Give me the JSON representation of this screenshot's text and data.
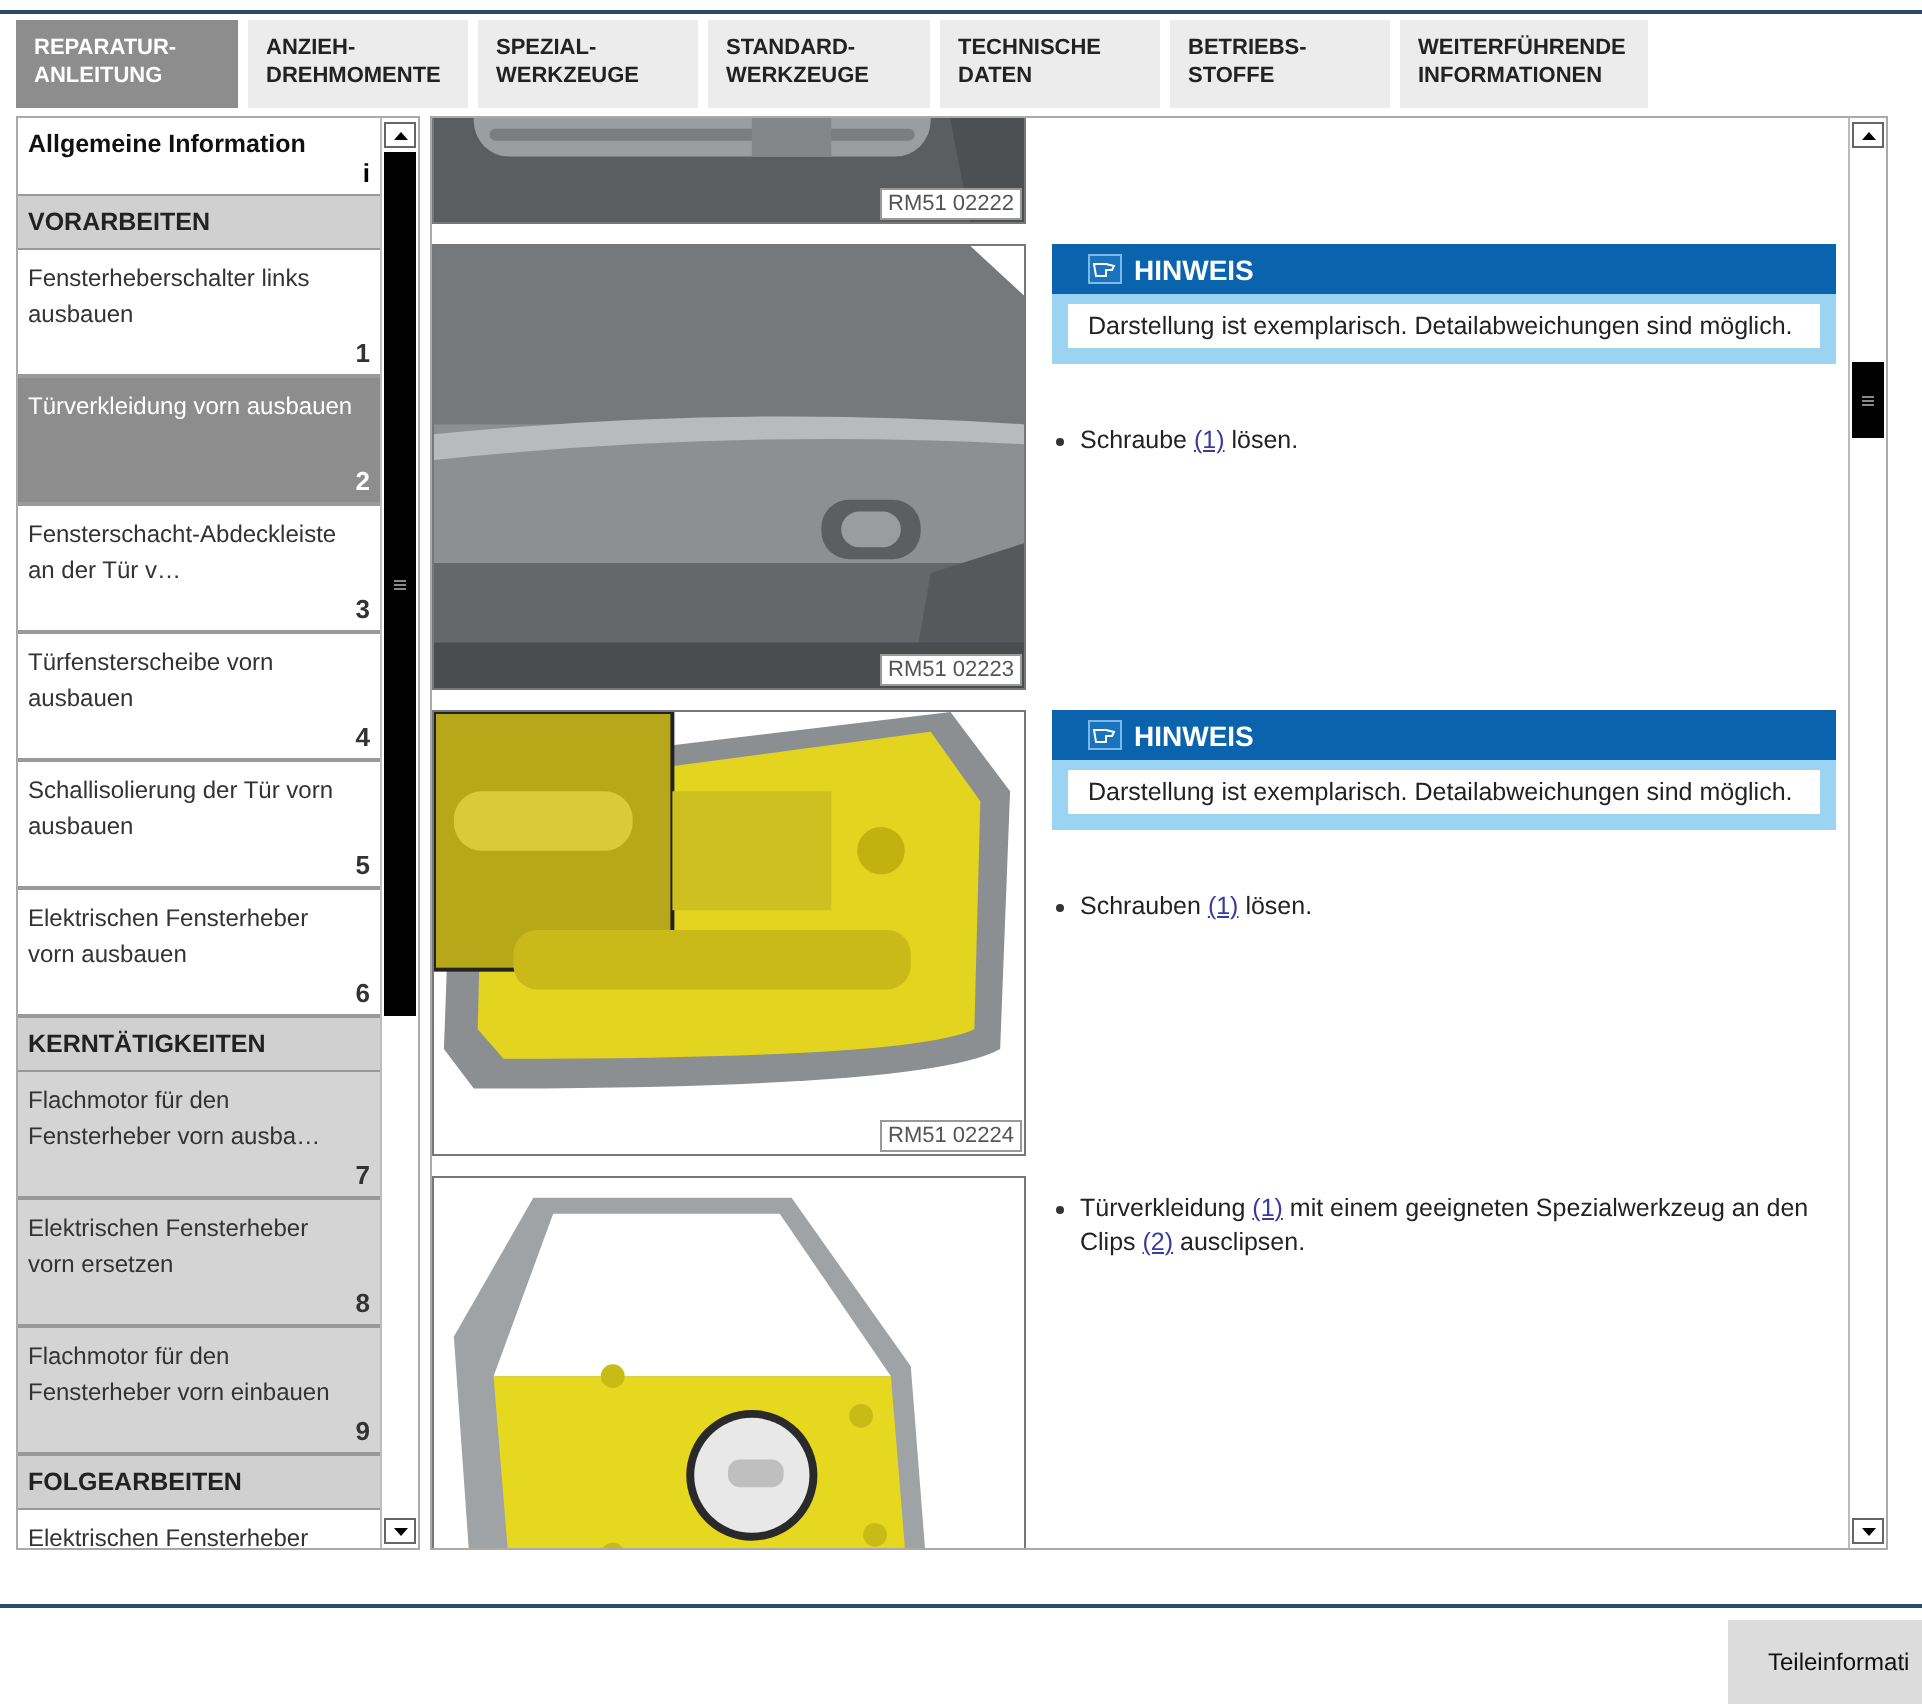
{
  "tabs": [
    {
      "lines": [
        "REPARATUR-",
        "ANLEITUNG"
      ],
      "selected": true
    },
    {
      "lines": [
        "ANZIEH-",
        "DREHMOMENTE"
      ],
      "selected": false
    },
    {
      "lines": [
        "SPEZIAL-",
        "WERKZEUGE"
      ],
      "selected": false
    },
    {
      "lines": [
        "STANDARD-",
        "WERKZEUGE"
      ],
      "selected": false
    },
    {
      "lines": [
        "TECHNISCHE",
        "DATEN"
      ],
      "selected": false
    },
    {
      "lines": [
        "BETRIEBS-",
        "STOFFE"
      ],
      "selected": false
    },
    {
      "lines": [
        "WEITERFÜHRENDE",
        "INFORMATIONEN"
      ],
      "selected": false
    }
  ],
  "sidebar": {
    "intro": {
      "label": "Allgemeine Information",
      "marker": "i"
    },
    "sections": [
      {
        "title": "VORARBEITEN",
        "shaded": false,
        "items": [
          {
            "label": "Fensterheberschalter links ausbauen",
            "number": "1",
            "selected": false
          },
          {
            "label": "Türverkleidung vorn ausbauen",
            "number": "2",
            "selected": true
          },
          {
            "label": "Fensterschacht-Abdeckleiste an der Tür v…",
            "number": "3",
            "selected": false
          },
          {
            "label": "Türfensterscheibe vorn ausbauen",
            "number": "4",
            "selected": false
          },
          {
            "label": "Schallisolierung der Tür vorn ausbauen",
            "number": "5",
            "selected": false
          },
          {
            "label": "Elektrischen Fensterheber vorn ausbauen",
            "number": "6",
            "selected": false
          }
        ]
      },
      {
        "title": "KERNTÄTIGKEITEN",
        "shaded": true,
        "items": [
          {
            "label": "Flachmotor für den Fensterheber vorn ausba…",
            "number": "7",
            "selected": false
          },
          {
            "label": "Elektrischen Fensterheber vorn ersetzen",
            "number": "8",
            "selected": false
          },
          {
            "label": "Flachmotor für den Fensterheber vorn einbauen",
            "number": "9",
            "selected": false
          }
        ]
      },
      {
        "title": "FOLGEARBEITEN",
        "shaded": false,
        "items": [
          {
            "label": "Elektrischen Fensterheber",
            "selected": false
          }
        ]
      }
    ]
  },
  "steps": [
    {
      "caption": "RM51 02222"
    },
    {
      "caption": "RM51 02223",
      "hint": {
        "title": "HINWEIS",
        "text": "Darstellung ist exemplarisch. Detailabweichungen sind möglich."
      },
      "bullets": [
        [
          {
            "kind": "text",
            "text": "Schraube "
          },
          {
            "kind": "link",
            "text": "(1)"
          },
          {
            "kind": "text",
            "text": " lösen."
          }
        ]
      ]
    },
    {
      "caption": "RM51 02224",
      "hint": {
        "title": "HINWEIS",
        "text": "Darstellung ist exemplarisch. Detailabweichungen sind möglich."
      },
      "bullets": [
        [
          {
            "kind": "text",
            "text": "Schrauben "
          },
          {
            "kind": "link",
            "text": "(1)"
          },
          {
            "kind": "text",
            "text": " lösen."
          }
        ]
      ]
    },
    {
      "bullets": [
        [
          {
            "kind": "text",
            "text": "Türverkleidung "
          },
          {
            "kind": "link",
            "text": "(1)"
          },
          {
            "kind": "text",
            "text": " mit einem geeigneten Spezialwerkzeug an den Clips "
          },
          {
            "kind": "link",
            "text": "(2)"
          },
          {
            "kind": "text",
            "text": " ausclipsen."
          }
        ]
      ]
    }
  ],
  "footer": {
    "button": "Teileinformati"
  }
}
